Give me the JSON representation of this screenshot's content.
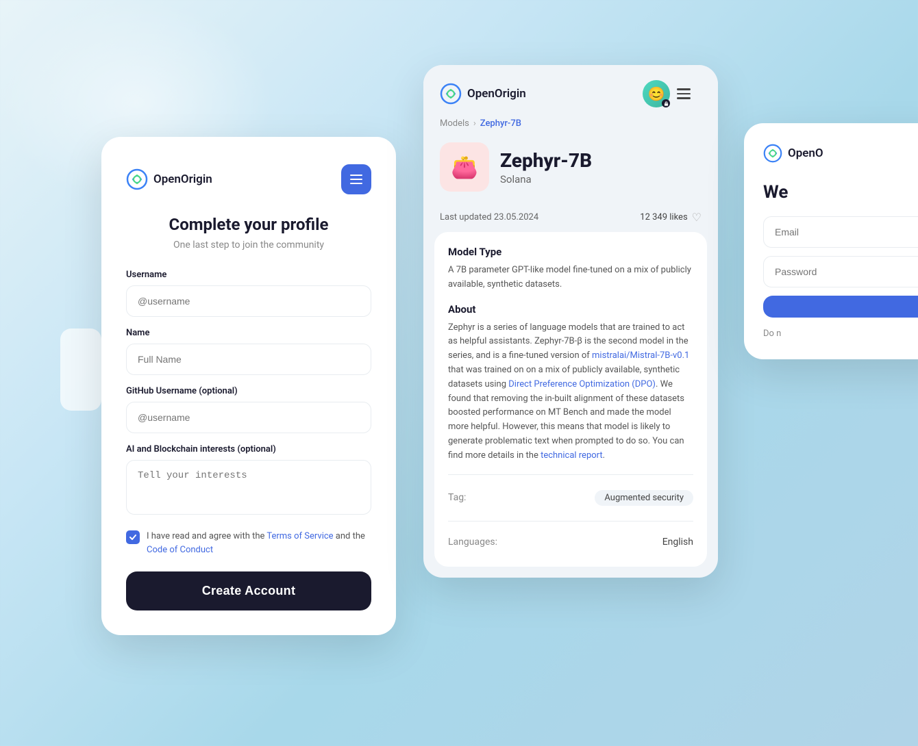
{
  "background": {
    "gradient": "linear-gradient(135deg, #e8f4f8, #c8e6f5, #a8d8ea)"
  },
  "left_card": {
    "logo_text": "OpenOrigin",
    "title": "Complete your profile",
    "subtitle": "One last step to join the community",
    "fields": [
      {
        "label": "Username",
        "placeholder": "@username",
        "type": "text",
        "name": "username"
      },
      {
        "label": "Name",
        "placeholder": "Full Name",
        "type": "text",
        "name": "name"
      },
      {
        "label": "GitHub Username (optional)",
        "placeholder": "@username",
        "type": "text",
        "name": "github"
      },
      {
        "label": "AI and Blockchain interests (optional)",
        "placeholder": "Tell your interests",
        "type": "textarea",
        "name": "interests"
      }
    ],
    "checkbox_text_before": "I have read and agree with the ",
    "checkbox_link1": "Terms of Service",
    "checkbox_text_mid": " and the ",
    "checkbox_link2": "Code of Conduct",
    "create_btn": "Create Account"
  },
  "middle_card": {
    "logo_text": "OpenOrigin",
    "breadcrumb_models": "Models",
    "breadcrumb_sep": ">",
    "breadcrumb_current": "Zephyr-7B",
    "model_emoji": "👛",
    "model_name": "Zephyr-7B",
    "model_chain": "Solana",
    "last_updated": "Last updated 23.05.2024",
    "likes": "12 349 likes",
    "section_model_type": "Model Type",
    "model_type_desc": "A 7B parameter GPT-like model fine-tuned on a mix of publicly available, synthetic datasets.",
    "section_about": "About",
    "about_text_1": "Zephyr is a series of language models that are trained to act as helpful assistants. Zephyr-7B-β is the second model in the series, and is a fine-tuned version of ",
    "about_link1": "mistralai/Mistral-7B-v0.1",
    "about_text_2": " that was trained on on a mix of publicly available, synthetic datasets using ",
    "about_link2": "Direct Preference Optimization (DPO)",
    "about_text_3": ". We found that removing the in-built alignment of these datasets boosted performance on MT Bench and made the model more helpful. However, this means that model is likely to generate problematic text when prompted to do so. You can find more details in the ",
    "about_link3": "technical report",
    "about_text_4": ".",
    "tag_label": "Tag:",
    "tag_value": "Augmented security",
    "lang_label": "Languages:",
    "lang_value": "English"
  },
  "right_card": {
    "logo_text": "OpenO",
    "welcome_title": "We",
    "email_placeholder": "Email",
    "password_placeholder": "Password",
    "login_btn": "",
    "do_not_text": "Do n"
  }
}
